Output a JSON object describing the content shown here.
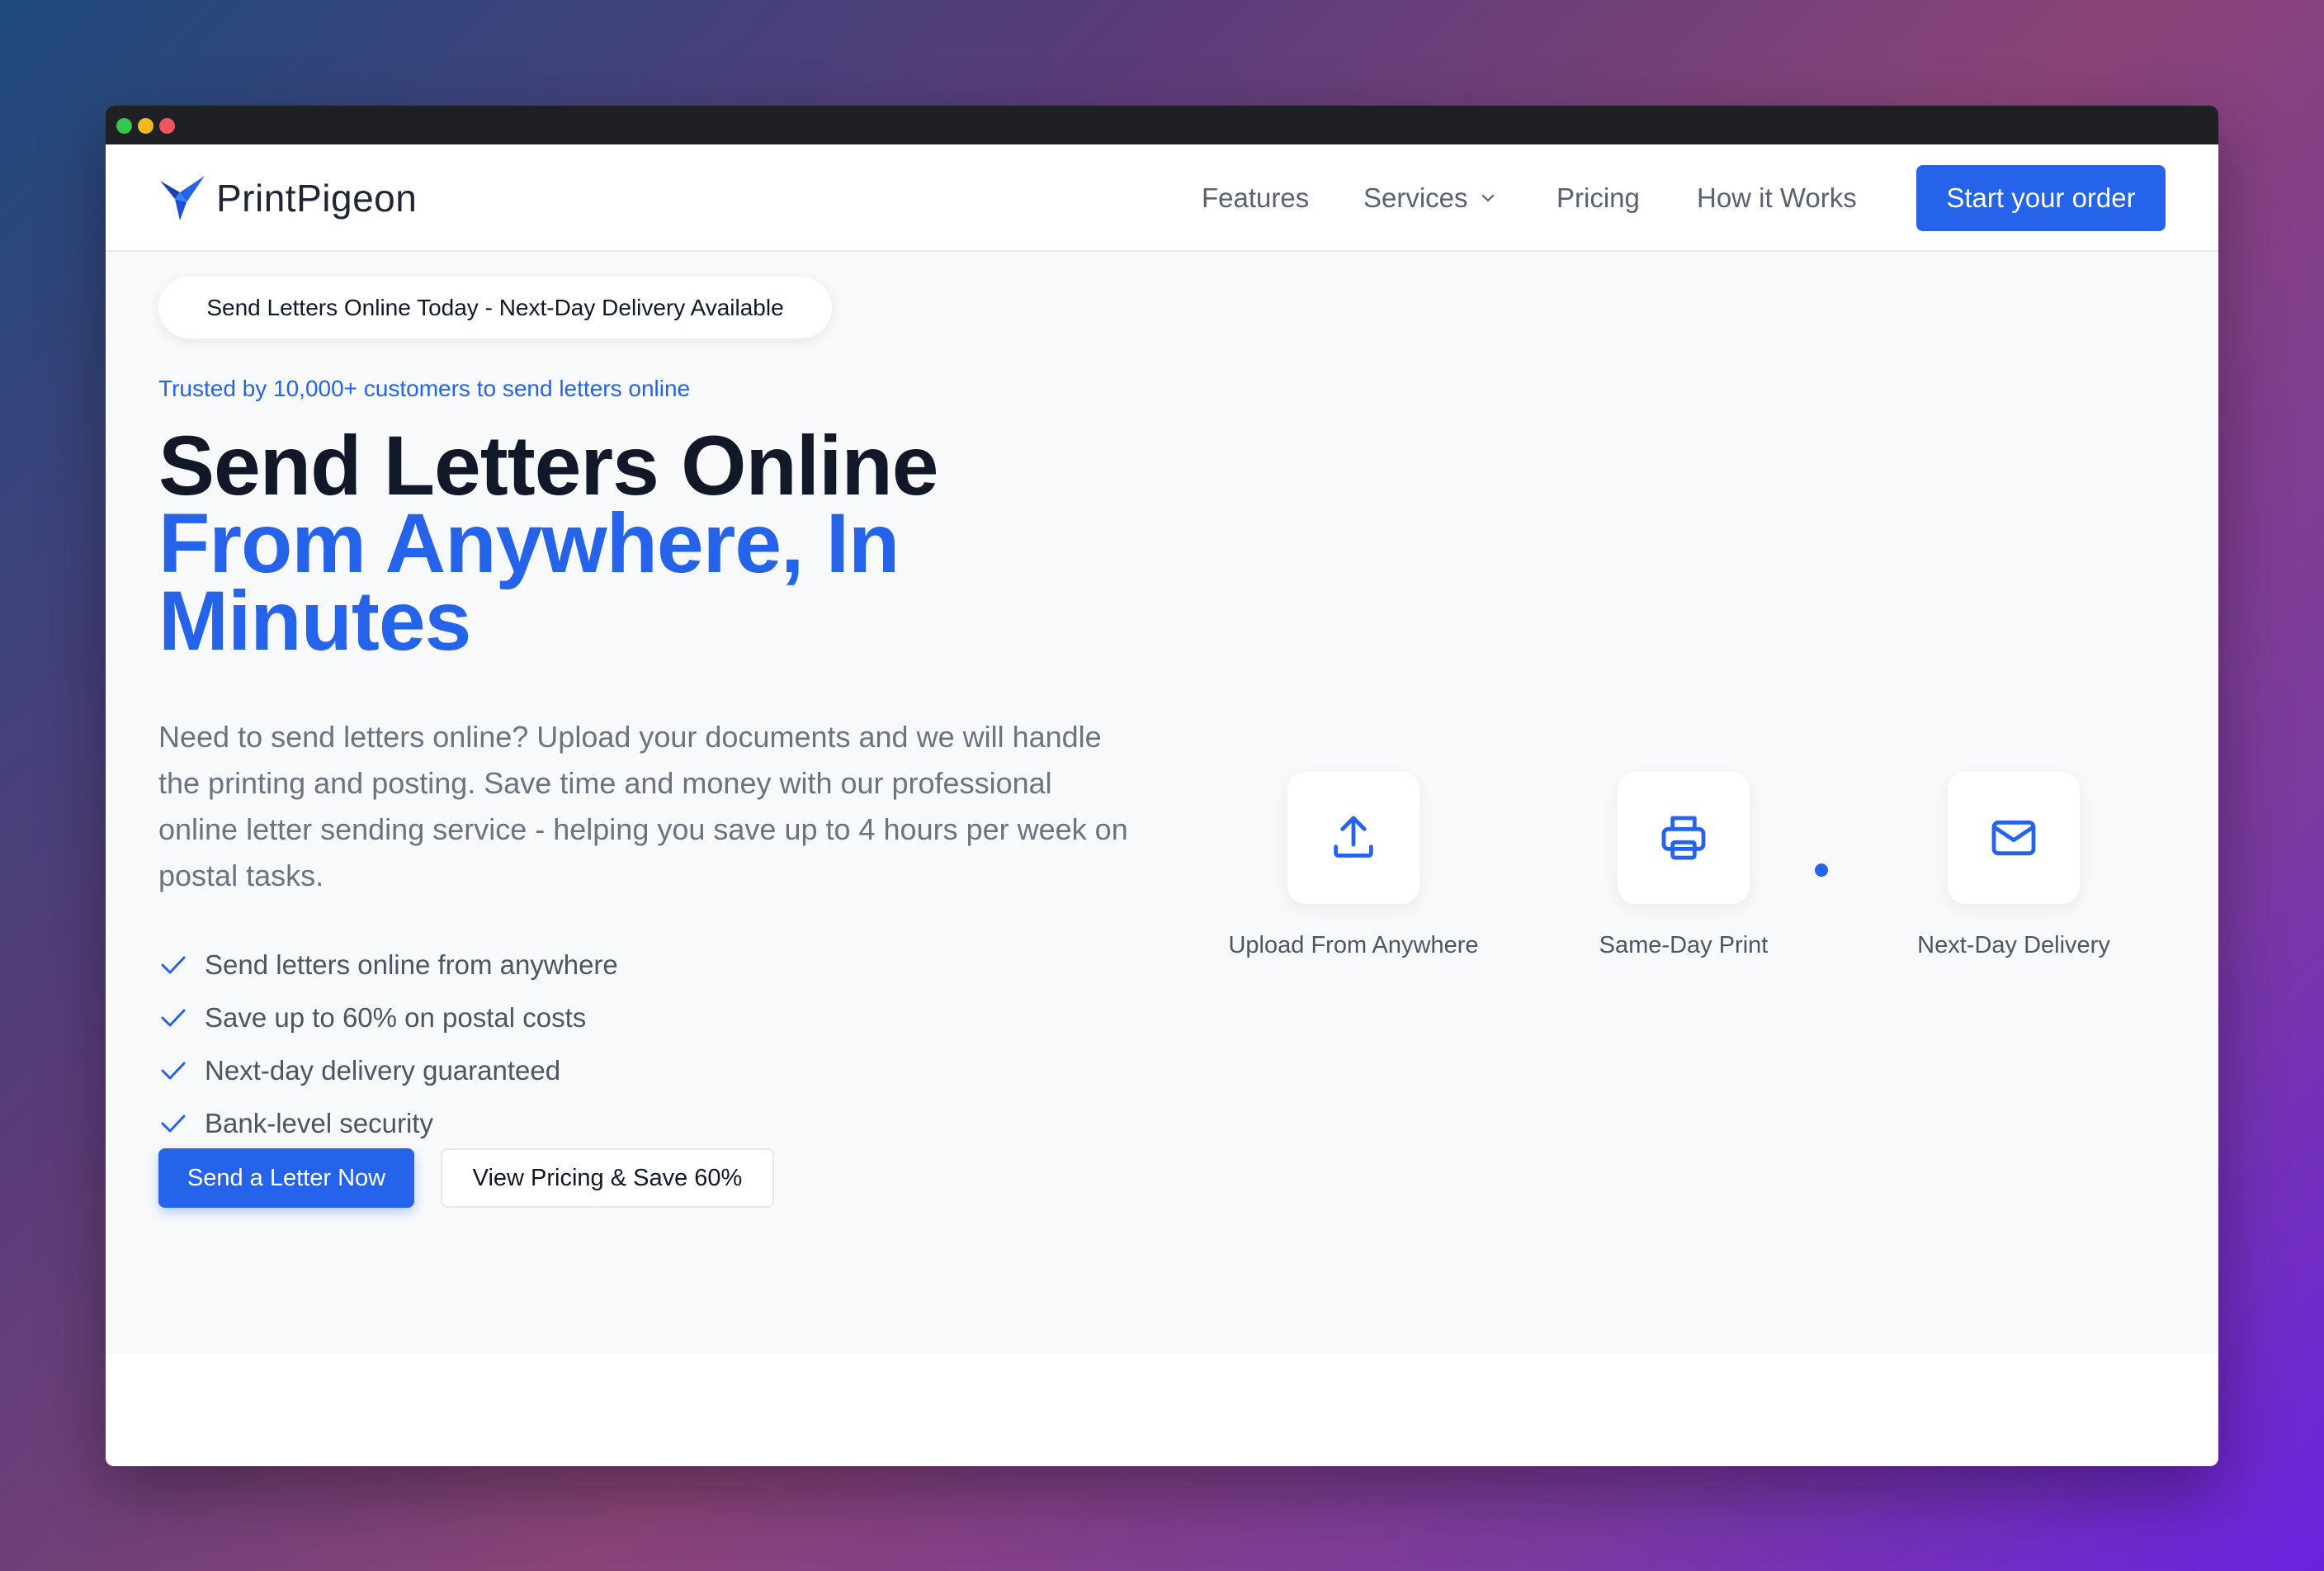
{
  "window": {
    "controls": [
      "green",
      "yellow",
      "red"
    ]
  },
  "nav": {
    "brand": "PrintPigeon",
    "links": [
      "Features",
      "Services",
      "Pricing",
      "How it Works"
    ],
    "cta": "Start your order"
  },
  "hero": {
    "badge": "Send Letters Online Today - Next-Day Delivery Available",
    "trusted": "Trusted by 10,000+ customers to send letters online",
    "headline_line1": "Send Letters Online",
    "headline_line2": "From Anywhere, In",
    "headline_line3": "Minutes",
    "lead": "Need to send letters online? Upload your documents and we will handle the printing and posting. Save time and money with our professional online letter sending service - helping you save up to 4 hours per week on postal tasks.",
    "features": [
      "Send letters online from anywhere",
      "Save up to 60% on postal costs",
      "Next-day delivery guaranteed",
      "Bank-level security"
    ],
    "primary_button": "Send a Letter Now",
    "secondary_button": "View Pricing & Save 60%"
  },
  "steps": [
    {
      "label": "Upload From Anywhere",
      "icon": "upload-icon"
    },
    {
      "label": "Same-Day Print",
      "icon": "printer-icon"
    },
    {
      "label": "Next-Day Delivery",
      "icon": "mail-icon"
    }
  ],
  "colors": {
    "accent": "#2563eb",
    "heading": "#111827",
    "body_text": "#6b7280"
  }
}
